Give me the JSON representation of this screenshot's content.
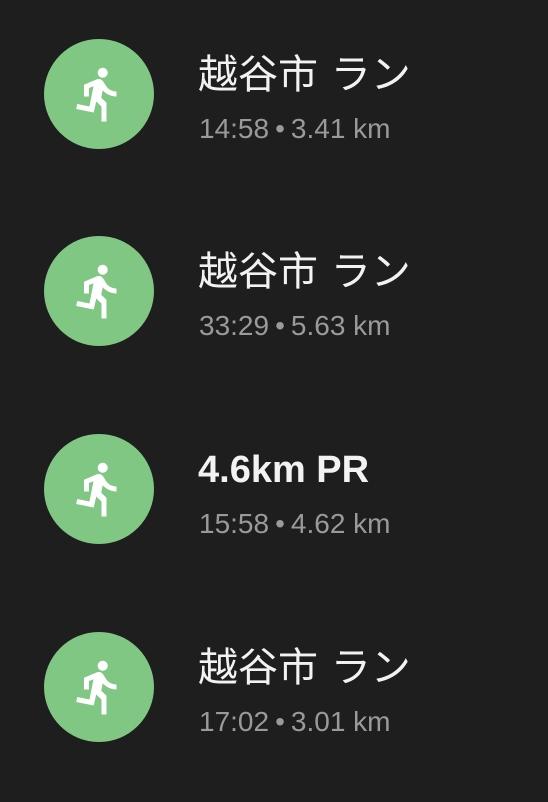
{
  "colors": {
    "background": "#1e1e1e",
    "icon_circle": "#81c784",
    "title_text": "#f2f2f2",
    "subtitle_text": "#9a9a9a"
  },
  "activities": [
    {
      "icon": "running-icon",
      "title": "越谷市 ラン",
      "duration": "14:58",
      "separator": "•",
      "distance": "3.41 km"
    },
    {
      "icon": "running-icon",
      "title": "越谷市 ラン",
      "duration": "33:29",
      "separator": "•",
      "distance": "5.63 km"
    },
    {
      "icon": "running-icon",
      "title": "4.6km PR",
      "duration": "15:58",
      "separator": "•",
      "distance": "4.62 km"
    },
    {
      "icon": "running-icon",
      "title": "越谷市 ラン",
      "duration": "17:02",
      "separator": "•",
      "distance": "3.01 km"
    }
  ]
}
